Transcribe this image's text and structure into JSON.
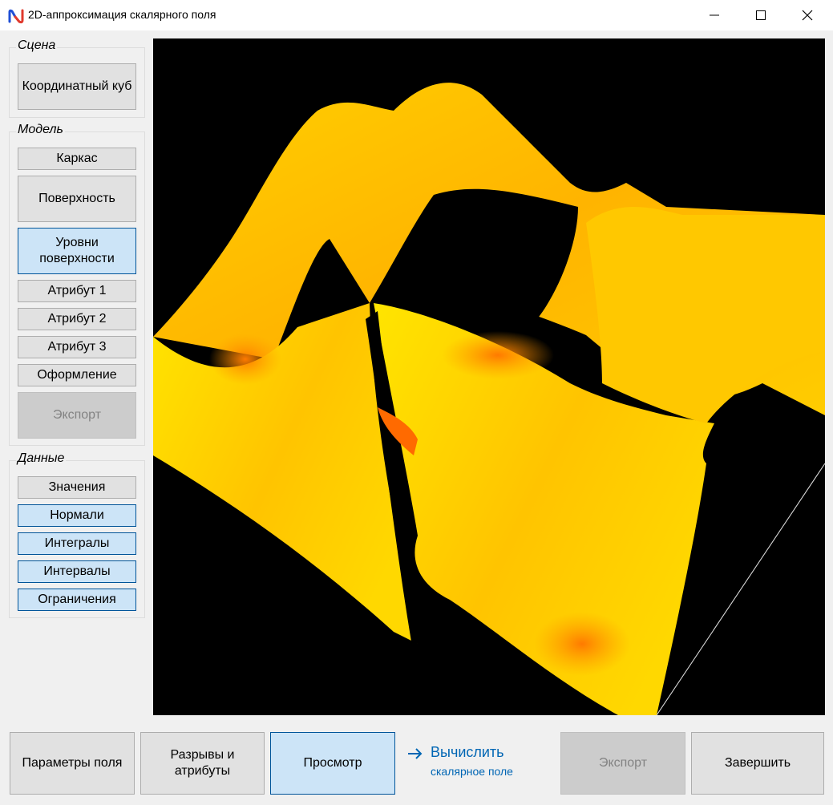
{
  "window": {
    "title": "2D-аппроксимация скалярного поля",
    "icon": "app-logo-icon",
    "controls": [
      "minimize-icon",
      "maximize-icon",
      "close-icon"
    ]
  },
  "scene_group": {
    "legend": "Сцена",
    "coord_cube": "Координатный куб"
  },
  "model_group": {
    "legend": "Модель",
    "frame": "Каркас",
    "surface": "Поверхность",
    "levels": "Уровни поверхности",
    "attr1": "Атрибут 1",
    "attr2": "Атрибут 2",
    "attr3": "Атрибут 3",
    "design": "Оформление",
    "export": "Экспорт"
  },
  "data_group": {
    "legend": "Данные",
    "values": "Значения",
    "normals": "Нормали",
    "integrals": "Интегралы",
    "intervals": "Интервалы",
    "constraints": "Ограничения"
  },
  "bottom": {
    "field_params": "Параметры поля",
    "breaks": "Разрывы и атрибуты",
    "preview": "Просмотр",
    "calc_main": "Вычислить",
    "calc_sub": "скалярное поле",
    "export": "Экспорт",
    "finish": "Завершить"
  },
  "colors": {
    "selected_bg": "#cce4f7",
    "selected_border": "#005499",
    "link": "#0066b4",
    "viewport_bg": "#000000"
  }
}
